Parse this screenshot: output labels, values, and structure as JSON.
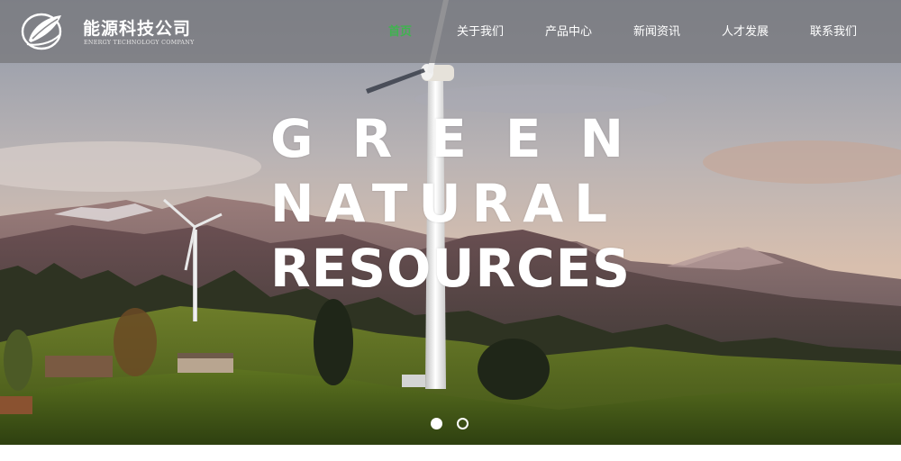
{
  "brand": {
    "name": "能源科技公司",
    "subtitle": "ENERGY TECHNOLOGY COMPANY",
    "icon": "leaf-swirl-logo-icon"
  },
  "nav": {
    "items": [
      {
        "label": "首页",
        "active": true
      },
      {
        "label": "关于我们",
        "active": false
      },
      {
        "label": "产品中心",
        "active": false
      },
      {
        "label": "新闻资讯",
        "active": false
      },
      {
        "label": "人才发展",
        "active": false
      },
      {
        "label": "联系我们",
        "active": false
      }
    ],
    "active_color": "#3fb34f"
  },
  "hero": {
    "headline": [
      "GREEN",
      "NATURAL",
      "RESOURCES"
    ],
    "slide_count": 2,
    "active_slide": 1
  }
}
